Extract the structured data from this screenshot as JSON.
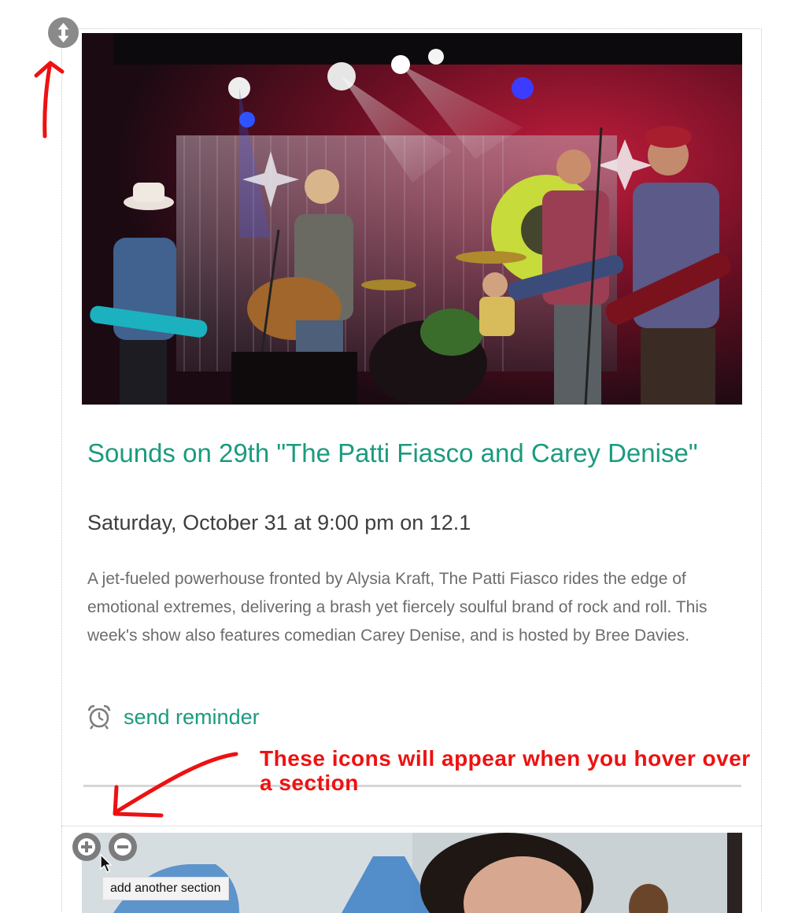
{
  "event": {
    "image_alt": "Live band performing on stage",
    "title": "Sounds on 29th \"The Patti Fiasco and Carey Denise\"",
    "airtime": "Saturday, October 31 at 9:00 pm on 12.1",
    "description": "A jet-fueled powerhouse fronted by Alysia Kraft, The Patti Fiasco rides the edge of emotional extremes, delivering a brash yet fiercely soulful brand of rock and roll. This week's show also features comedian Carey Denise, and is hosted by Bree Davies.",
    "reminder": {
      "icon": "alarm-clock-icon",
      "label": "send reminder"
    }
  },
  "annotation": {
    "text": "These icons will appear when you hover over a section"
  },
  "section_controls": {
    "move_icon": "up-down-arrows-icon",
    "add_icon": "plus-circle-icon",
    "remove_icon": "minus-circle-icon",
    "add_tooltip": "add another section"
  },
  "colors": {
    "link_green": "#1a9b7f",
    "annotation_red": "#ee1111",
    "control_gray": "#8a8a8a"
  }
}
